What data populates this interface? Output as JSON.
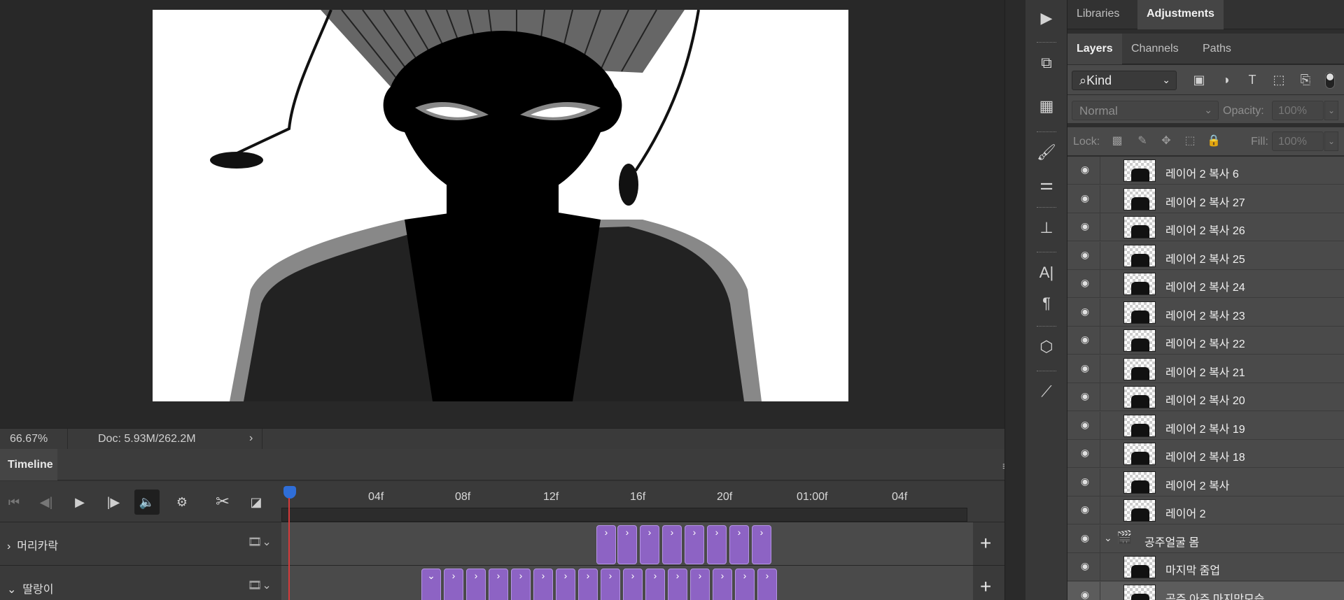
{
  "status": {
    "zoom": "66.67%",
    "doc": "Doc: 5.93M/262.2M"
  },
  "timeline": {
    "title": "Timeline",
    "ticks": [
      "04f",
      "08f",
      "12f",
      "16f",
      "20f",
      "01:00f",
      "04f"
    ],
    "tracks": [
      {
        "label": "머리카락",
        "expand": "›"
      },
      {
        "label": "딸랑이",
        "expand": "⌄"
      }
    ]
  },
  "panels": {
    "top_tabs": [
      "Libraries",
      "Adjustments"
    ],
    "mid_tabs": [
      "Layers",
      "Channels",
      "Paths"
    ],
    "filter": {
      "kind": "Kind"
    },
    "blend": {
      "mode": "Normal",
      "opacity_label": "Opacity:",
      "opacity_value": "100%"
    },
    "lock": {
      "label": "Lock:",
      "fill_label": "Fill:",
      "fill_value": "100%"
    }
  },
  "layers": [
    {
      "name": "레이어 2 복사 6"
    },
    {
      "name": "레이어 2 복사 27"
    },
    {
      "name": "레이어 2 복사 26"
    },
    {
      "name": "레이어 2 복사 25"
    },
    {
      "name": "레이어 2 복사 24"
    },
    {
      "name": "레이어 2 복사 23"
    },
    {
      "name": "레이어 2 복사 22"
    },
    {
      "name": "레이어 2 복사 21"
    },
    {
      "name": "레이어 2 복사 20"
    },
    {
      "name": "레이어 2 복사 19"
    },
    {
      "name": "레이어 2 복사 18"
    },
    {
      "name": "레이어 2 복사"
    },
    {
      "name": "레이어 2"
    },
    {
      "name": "공주얼굴 몸",
      "group": true
    },
    {
      "name": "마지막 줌업"
    },
    {
      "name": "공주 아주 마지막모습",
      "selected": true
    }
  ],
  "colors": {
    "accent": "#2f6ed8",
    "clip": "#8d63c4",
    "playhead": "#d63a3a"
  }
}
